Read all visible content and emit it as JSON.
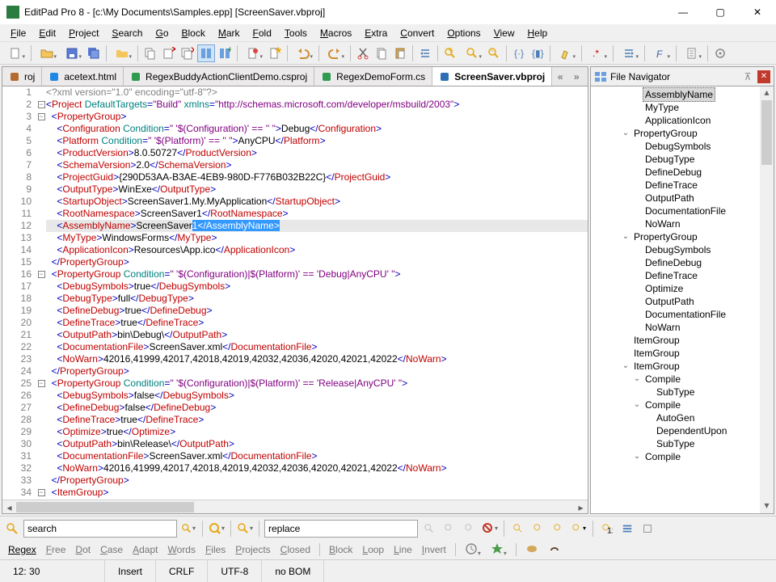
{
  "window": {
    "title": "EditPad Pro 8 - [c:\\My Documents\\Samples.epp] [ScreenSaver.vbproj]"
  },
  "menu": [
    "File",
    "Edit",
    "Project",
    "Search",
    "Go",
    "Block",
    "Mark",
    "Fold",
    "Tools",
    "Macros",
    "Extra",
    "Convert",
    "Options",
    "View",
    "Help"
  ],
  "tabs": [
    {
      "label": "roj",
      "icon": "#b36b2e"
    },
    {
      "label": "acetext.html",
      "icon": "#1e88e5"
    },
    {
      "label": "RegexBuddyActionClientDemo.csproj",
      "icon": "#2e9b4f"
    },
    {
      "label": "RegexDemoForm.cs",
      "icon": "#2e9b4f"
    },
    {
      "label": "ScreenSaver.vbproj",
      "icon": "#2e6fb3",
      "active": true
    }
  ],
  "gutter_start": 1,
  "gutter_count": 34,
  "fold": {
    "2": "-",
    "3": "-",
    "16": "-",
    "25": "-",
    "34": "-"
  },
  "code": [
    [
      [
        "pi",
        "<?xml version=\"1.0\" encoding=\"utf-8\"?>"
      ]
    ],
    [
      [
        "tag",
        "<"
      ],
      [
        "red",
        "Project"
      ],
      [
        "attr",
        " DefaultTargets"
      ],
      [
        "tag",
        "="
      ],
      [
        "str",
        "\"Build\""
      ],
      [
        "attr",
        " xmlns"
      ],
      [
        "tag",
        "="
      ],
      [
        "str",
        "\"http://schemas.microsoft.com/developer/msbuild/2003\""
      ],
      [
        "tag",
        ">"
      ]
    ],
    [
      [
        "txt",
        "  "
      ],
      [
        "tag",
        "<"
      ],
      [
        "red",
        "PropertyGroup"
      ],
      [
        "tag",
        ">"
      ]
    ],
    [
      [
        "txt",
        "    "
      ],
      [
        "tag",
        "<"
      ],
      [
        "red",
        "Configuration"
      ],
      [
        "attr",
        " Condition"
      ],
      [
        "tag",
        "="
      ],
      [
        "str",
        "\" '$(Configuration)' == '' \""
      ],
      [
        "tag",
        ">"
      ],
      [
        "txt",
        "Debug"
      ],
      [
        "tag",
        "</"
      ],
      [
        "red",
        "Configuration"
      ],
      [
        "tag",
        ">"
      ]
    ],
    [
      [
        "txt",
        "    "
      ],
      [
        "tag",
        "<"
      ],
      [
        "red",
        "Platform"
      ],
      [
        "attr",
        " Condition"
      ],
      [
        "tag",
        "="
      ],
      [
        "str",
        "\" '$(Platform)' == '' \""
      ],
      [
        "tag",
        ">"
      ],
      [
        "txt",
        "AnyCPU"
      ],
      [
        "tag",
        "</"
      ],
      [
        "red",
        "Platform"
      ],
      [
        "tag",
        ">"
      ]
    ],
    [
      [
        "txt",
        "    "
      ],
      [
        "tag",
        "<"
      ],
      [
        "red",
        "ProductVersion"
      ],
      [
        "tag",
        ">"
      ],
      [
        "txt",
        "8.0.50727"
      ],
      [
        "tag",
        "</"
      ],
      [
        "red",
        "ProductVersion"
      ],
      [
        "tag",
        ">"
      ]
    ],
    [
      [
        "txt",
        "    "
      ],
      [
        "tag",
        "<"
      ],
      [
        "red",
        "SchemaVersion"
      ],
      [
        "tag",
        ">"
      ],
      [
        "txt",
        "2.0"
      ],
      [
        "tag",
        "</"
      ],
      [
        "red",
        "SchemaVersion"
      ],
      [
        "tag",
        ">"
      ]
    ],
    [
      [
        "txt",
        "    "
      ],
      [
        "tag",
        "<"
      ],
      [
        "red",
        "ProjectGuid"
      ],
      [
        "tag",
        ">"
      ],
      [
        "txt",
        "{290D53AA-B3AE-4EB9-980D-F776B032B22C}"
      ],
      [
        "tag",
        "</"
      ],
      [
        "red",
        "ProjectGuid"
      ],
      [
        "tag",
        ">"
      ]
    ],
    [
      [
        "txt",
        "    "
      ],
      [
        "tag",
        "<"
      ],
      [
        "red",
        "OutputType"
      ],
      [
        "tag",
        ">"
      ],
      [
        "txt",
        "WinExe"
      ],
      [
        "tag",
        "</"
      ],
      [
        "red",
        "OutputType"
      ],
      [
        "tag",
        ">"
      ]
    ],
    [
      [
        "txt",
        "    "
      ],
      [
        "tag",
        "<"
      ],
      [
        "red",
        "StartupObject"
      ],
      [
        "tag",
        ">"
      ],
      [
        "txt",
        "ScreenSaver1.My.MyApplication"
      ],
      [
        "tag",
        "</"
      ],
      [
        "red",
        "StartupObject"
      ],
      [
        "tag",
        ">"
      ]
    ],
    [
      [
        "txt",
        "    "
      ],
      [
        "tag",
        "<"
      ],
      [
        "red",
        "RootNamespace"
      ],
      [
        "tag",
        ">"
      ],
      [
        "txt",
        "ScreenSaver1"
      ],
      [
        "tag",
        "</"
      ],
      [
        "red",
        "RootNamespace"
      ],
      [
        "tag",
        ">"
      ]
    ],
    [
      [
        "txt",
        "    "
      ],
      [
        "tag",
        "<"
      ],
      [
        "red",
        "AssemblyName"
      ],
      [
        "tag",
        ">"
      ],
      [
        "txt",
        "ScreenSaver"
      ],
      [
        "sel",
        "1</AssemblyName>"
      ]
    ],
    [
      [
        "txt",
        "    "
      ],
      [
        "tag",
        "<"
      ],
      [
        "red",
        "MyType"
      ],
      [
        "tag",
        ">"
      ],
      [
        "txt",
        "WindowsForms"
      ],
      [
        "tag",
        "</"
      ],
      [
        "red",
        "MyType"
      ],
      [
        "tag",
        ">"
      ]
    ],
    [
      [
        "txt",
        "    "
      ],
      [
        "tag",
        "<"
      ],
      [
        "red",
        "ApplicationIcon"
      ],
      [
        "tag",
        ">"
      ],
      [
        "txt",
        "Resources\\App.ico"
      ],
      [
        "tag",
        "</"
      ],
      [
        "red",
        "ApplicationIcon"
      ],
      [
        "tag",
        ">"
      ]
    ],
    [
      [
        "txt",
        "  "
      ],
      [
        "tag",
        "</"
      ],
      [
        "red",
        "PropertyGroup"
      ],
      [
        "tag",
        ">"
      ]
    ],
    [
      [
        "txt",
        "  "
      ],
      [
        "tag",
        "<"
      ],
      [
        "red",
        "PropertyGroup"
      ],
      [
        "attr",
        " Condition"
      ],
      [
        "tag",
        "="
      ],
      [
        "str",
        "\" '$(Configuration)|$(Platform)' == 'Debug|AnyCPU' \""
      ],
      [
        "tag",
        ">"
      ]
    ],
    [
      [
        "txt",
        "    "
      ],
      [
        "tag",
        "<"
      ],
      [
        "red",
        "DebugSymbols"
      ],
      [
        "tag",
        ">"
      ],
      [
        "txt",
        "true"
      ],
      [
        "tag",
        "</"
      ],
      [
        "red",
        "DebugSymbols"
      ],
      [
        "tag",
        ">"
      ]
    ],
    [
      [
        "txt",
        "    "
      ],
      [
        "tag",
        "<"
      ],
      [
        "red",
        "DebugType"
      ],
      [
        "tag",
        ">"
      ],
      [
        "txt",
        "full"
      ],
      [
        "tag",
        "</"
      ],
      [
        "red",
        "DebugType"
      ],
      [
        "tag",
        ">"
      ]
    ],
    [
      [
        "txt",
        "    "
      ],
      [
        "tag",
        "<"
      ],
      [
        "red",
        "DefineDebug"
      ],
      [
        "tag",
        ">"
      ],
      [
        "txt",
        "true"
      ],
      [
        "tag",
        "</"
      ],
      [
        "red",
        "DefineDebug"
      ],
      [
        "tag",
        ">"
      ]
    ],
    [
      [
        "txt",
        "    "
      ],
      [
        "tag",
        "<"
      ],
      [
        "red",
        "DefineTrace"
      ],
      [
        "tag",
        ">"
      ],
      [
        "txt",
        "true"
      ],
      [
        "tag",
        "</"
      ],
      [
        "red",
        "DefineTrace"
      ],
      [
        "tag",
        ">"
      ]
    ],
    [
      [
        "txt",
        "    "
      ],
      [
        "tag",
        "<"
      ],
      [
        "red",
        "OutputPath"
      ],
      [
        "tag",
        ">"
      ],
      [
        "txt",
        "bin\\Debug\\"
      ],
      [
        "tag",
        "</"
      ],
      [
        "red",
        "OutputPath"
      ],
      [
        "tag",
        ">"
      ]
    ],
    [
      [
        "txt",
        "    "
      ],
      [
        "tag",
        "<"
      ],
      [
        "red",
        "DocumentationFile"
      ],
      [
        "tag",
        ">"
      ],
      [
        "txt",
        "ScreenSaver.xml"
      ],
      [
        "tag",
        "</"
      ],
      [
        "red",
        "DocumentationFile"
      ],
      [
        "tag",
        ">"
      ]
    ],
    [
      [
        "txt",
        "    "
      ],
      [
        "tag",
        "<"
      ],
      [
        "red",
        "NoWarn"
      ],
      [
        "tag",
        ">"
      ],
      [
        "txt",
        "42016,41999,42017,42018,42019,42032,42036,42020,42021,42022"
      ],
      [
        "tag",
        "</"
      ],
      [
        "red",
        "NoWarn"
      ],
      [
        "tag",
        ">"
      ]
    ],
    [
      [
        "txt",
        "  "
      ],
      [
        "tag",
        "</"
      ],
      [
        "red",
        "PropertyGroup"
      ],
      [
        "tag",
        ">"
      ]
    ],
    [
      [
        "txt",
        "  "
      ],
      [
        "tag",
        "<"
      ],
      [
        "red",
        "PropertyGroup"
      ],
      [
        "attr",
        " Condition"
      ],
      [
        "tag",
        "="
      ],
      [
        "str",
        "\" '$(Configuration)|$(Platform)' == 'Release|AnyCPU' \""
      ],
      [
        "tag",
        ">"
      ]
    ],
    [
      [
        "txt",
        "    "
      ],
      [
        "tag",
        "<"
      ],
      [
        "red",
        "DebugSymbols"
      ],
      [
        "tag",
        ">"
      ],
      [
        "txt",
        "false"
      ],
      [
        "tag",
        "</"
      ],
      [
        "red",
        "DebugSymbols"
      ],
      [
        "tag",
        ">"
      ]
    ],
    [
      [
        "txt",
        "    "
      ],
      [
        "tag",
        "<"
      ],
      [
        "red",
        "DefineDebug"
      ],
      [
        "tag",
        ">"
      ],
      [
        "txt",
        "false"
      ],
      [
        "tag",
        "</"
      ],
      [
        "red",
        "DefineDebug"
      ],
      [
        "tag",
        ">"
      ]
    ],
    [
      [
        "txt",
        "    "
      ],
      [
        "tag",
        "<"
      ],
      [
        "red",
        "DefineTrace"
      ],
      [
        "tag",
        ">"
      ],
      [
        "txt",
        "true"
      ],
      [
        "tag",
        "</"
      ],
      [
        "red",
        "DefineTrace"
      ],
      [
        "tag",
        ">"
      ]
    ],
    [
      [
        "txt",
        "    "
      ],
      [
        "tag",
        "<"
      ],
      [
        "red",
        "Optimize"
      ],
      [
        "tag",
        ">"
      ],
      [
        "txt",
        "true"
      ],
      [
        "tag",
        "</"
      ],
      [
        "red",
        "Optimize"
      ],
      [
        "tag",
        ">"
      ]
    ],
    [
      [
        "txt",
        "    "
      ],
      [
        "tag",
        "<"
      ],
      [
        "red",
        "OutputPath"
      ],
      [
        "tag",
        ">"
      ],
      [
        "txt",
        "bin\\Release\\"
      ],
      [
        "tag",
        "</"
      ],
      [
        "red",
        "OutputPath"
      ],
      [
        "tag",
        ">"
      ]
    ],
    [
      [
        "txt",
        "    "
      ],
      [
        "tag",
        "<"
      ],
      [
        "red",
        "DocumentationFile"
      ],
      [
        "tag",
        ">"
      ],
      [
        "txt",
        "ScreenSaver.xml"
      ],
      [
        "tag",
        "</"
      ],
      [
        "red",
        "DocumentationFile"
      ],
      [
        "tag",
        ">"
      ]
    ],
    [
      [
        "txt",
        "    "
      ],
      [
        "tag",
        "<"
      ],
      [
        "red",
        "NoWarn"
      ],
      [
        "tag",
        ">"
      ],
      [
        "txt",
        "42016,41999,42017,42018,42019,42032,42036,42020,42021,42022"
      ],
      [
        "tag",
        "</"
      ],
      [
        "red",
        "NoWarn"
      ],
      [
        "tag",
        ">"
      ]
    ],
    [
      [
        "txt",
        "  "
      ],
      [
        "tag",
        "</"
      ],
      [
        "red",
        "PropertyGroup"
      ],
      [
        "tag",
        ">"
      ]
    ],
    [
      [
        "txt",
        "  "
      ],
      [
        "tag",
        "<"
      ],
      [
        "red",
        "ItemGroup"
      ],
      [
        "tag",
        ">"
      ]
    ]
  ],
  "current_line_index": 11,
  "navigator": {
    "title": "File Navigator",
    "items": [
      {
        "indent": 3,
        "exp": "",
        "label": "AssemblyName",
        "sel": true
      },
      {
        "indent": 3,
        "exp": "",
        "label": "MyType"
      },
      {
        "indent": 3,
        "exp": "",
        "label": "ApplicationIcon"
      },
      {
        "indent": 2,
        "exp": "v",
        "label": "PropertyGroup"
      },
      {
        "indent": 3,
        "exp": "",
        "label": "DebugSymbols"
      },
      {
        "indent": 3,
        "exp": "",
        "label": "DebugType"
      },
      {
        "indent": 3,
        "exp": "",
        "label": "DefineDebug"
      },
      {
        "indent": 3,
        "exp": "",
        "label": "DefineTrace"
      },
      {
        "indent": 3,
        "exp": "",
        "label": "OutputPath"
      },
      {
        "indent": 3,
        "exp": "",
        "label": "DocumentationFile"
      },
      {
        "indent": 3,
        "exp": "",
        "label": "NoWarn"
      },
      {
        "indent": 2,
        "exp": "v",
        "label": "PropertyGroup"
      },
      {
        "indent": 3,
        "exp": "",
        "label": "DebugSymbols"
      },
      {
        "indent": 3,
        "exp": "",
        "label": "DefineDebug"
      },
      {
        "indent": 3,
        "exp": "",
        "label": "DefineTrace"
      },
      {
        "indent": 3,
        "exp": "",
        "label": "Optimize"
      },
      {
        "indent": 3,
        "exp": "",
        "label": "OutputPath"
      },
      {
        "indent": 3,
        "exp": "",
        "label": "DocumentationFile"
      },
      {
        "indent": 3,
        "exp": "",
        "label": "NoWarn"
      },
      {
        "indent": 2,
        "exp": "",
        "label": "ItemGroup"
      },
      {
        "indent": 2,
        "exp": "",
        "label": "ItemGroup"
      },
      {
        "indent": 2,
        "exp": "v",
        "label": "ItemGroup"
      },
      {
        "indent": 3,
        "exp": "v",
        "label": "Compile"
      },
      {
        "indent": 4,
        "exp": "",
        "label": "SubType"
      },
      {
        "indent": 3,
        "exp": "v",
        "label": "Compile"
      },
      {
        "indent": 4,
        "exp": "",
        "label": "AutoGen"
      },
      {
        "indent": 4,
        "exp": "",
        "label": "DependentUpon"
      },
      {
        "indent": 4,
        "exp": "",
        "label": "SubType"
      },
      {
        "indent": 3,
        "exp": "v",
        "label": "Compile"
      }
    ]
  },
  "search": {
    "find": "search",
    "replace": "replace"
  },
  "options": {
    "items": [
      "Regex",
      "Free",
      "Dot",
      "Case",
      "Adapt",
      "Words",
      "Files",
      "Projects",
      "Closed",
      "Block",
      "Loop",
      "Line",
      "Invert"
    ],
    "on": [
      0
    ]
  },
  "status": {
    "pos": "12: 30",
    "mode": "Insert",
    "eol": "CRLF",
    "enc": "UTF-8",
    "bom": "no BOM"
  }
}
